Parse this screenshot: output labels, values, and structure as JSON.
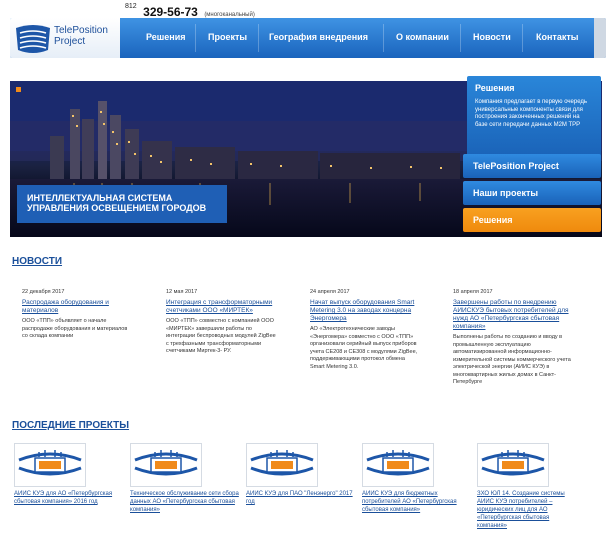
{
  "header": {
    "phone_code": "812",
    "phone_number": "329-56-73",
    "phone_note": "(многоканальный)",
    "logo_line1": "TelePosition",
    "logo_line2": "Project"
  },
  "nav": {
    "items": [
      "Решения",
      "Проекты",
      "География внедрения",
      "О компании",
      "Новости",
      "Контакты"
    ]
  },
  "hero": {
    "caption_line1": "Интеллектуальная система",
    "caption_line2": "управления освещением городов",
    "panel_title": "Решения",
    "panel_text": "Компания предлагает в первую очередь универсальные компоненты связи для построения законченных решений на базе сети передачи данных M2M TPP",
    "tabs": [
      "TelePosition Project",
      "Наши проекты",
      "Решения"
    ]
  },
  "news": {
    "title": "НОВОСТИ",
    "items": [
      {
        "date": "22 декабря 2017",
        "title": "Распродажа оборудования и материалов",
        "text": "ООО «ТПП» объявляет о начале распродаже оборудования и материалов со склада компании"
      },
      {
        "date": "12 мая 2017",
        "title": "Интеграция с трансформаторными счетчиками ООО «МИРТЕК»",
        "text": "ООО «ТПП» совместно с компанией ООО «МИРТЕК» завершили работы по интеграции беспроводных модулей ZigBee с трехфазными трансформаторными счетчиками Миртек-3- РУ."
      },
      {
        "date": "24 апреля 2017",
        "title": "Начат выпуск оборудования Smart Metering 3.0 на заводах концерна Энергомера",
        "text": "АО «Электротехнические заводы «Энергомера» совместно с ООО «ТПП» организовали серийный выпуск приборов учета CE208 и CE308 с модулями ZigBee, поддерживающими протокол обмена Smart Metering 3.0."
      },
      {
        "date": "18 апреля 2017",
        "title": "Завершены работы по внедрению АИИСКУЭ бытовых потребителей для нужд АО «Петербургская сбытовая компания»",
        "text": "Выполнены работы по созданию и вводу в промышленную эксплуатацию автоматизированной информационно-измерительной системы коммерческого учета электрической энергии (АИИС КУЭ) в многоквартирных жилых домах в Санкт-Петербурге"
      }
    ]
  },
  "projects": {
    "title": "ПОСЛЕДНИЕ ПРОЕКТЫ",
    "items": [
      {
        "title": "АИИС КУЭ для АО «Петербургская сбытовая компания» 2016 год"
      },
      {
        "title": "Техническое обслуживание сети сбора данных АО «Петербургская сбытовая компания»"
      },
      {
        "title": "АИИС КУЭ для ПАО \"Ленэнерго\" 2017 год"
      },
      {
        "title": "АИИС КУЭ для бюджетных потребителей АО «Петербургская сбытовая компания»"
      },
      {
        "title": "ЗХО ЮЛ 14. Создание системы АИИС КУЭ потребителей – юридических лиц для АО «Петербургская сбытовая компания»"
      }
    ]
  },
  "colors": {
    "brand_blue": "#1a64bd",
    "accent_orange": "#ef8a0d",
    "link_blue": "#1a4f9a"
  }
}
